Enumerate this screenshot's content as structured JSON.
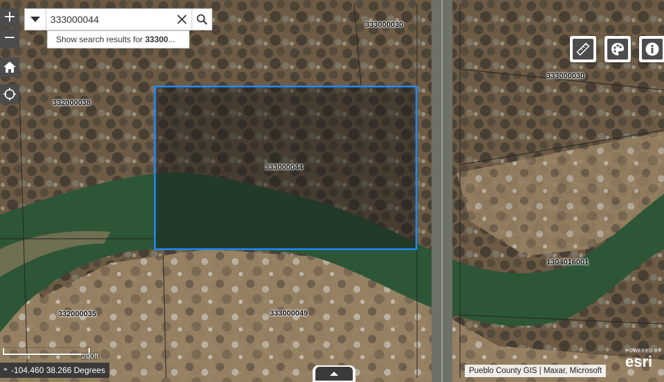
{
  "search": {
    "value": "333000044",
    "suggestion_prefix": "Show search results for ",
    "suggestion_bold": "33300",
    "suggestion_suffix": "..."
  },
  "map": {
    "zoom_in_label": "+",
    "zoom_out_label": "−",
    "parcels": [
      {
        "id": "p1",
        "label": "333000030"
      },
      {
        "id": "p2",
        "label": "333000030"
      },
      {
        "id": "p3",
        "label": "332000038"
      },
      {
        "id": "p4",
        "label": "333000044"
      },
      {
        "id": "p5",
        "label": "1304016001"
      },
      {
        "id": "p6",
        "label": "332000035"
      },
      {
        "id": "p7",
        "label": "333000049"
      }
    ],
    "selection_color": "#1e8cff"
  },
  "coordinates": "-104.460 38.266 Degrees",
  "scale_label": "200ft",
  "attribution": "Pueblo County GIS | Maxar, Microsoft",
  "esri": {
    "powered_by": "POWERED BY",
    "logo": "esri"
  },
  "icons": {
    "home": "home-icon",
    "locate": "locate-icon",
    "measure": "ruler-icon",
    "basemap": "palette-icon",
    "info": "info-icon",
    "search": "search-icon",
    "clear": "close-icon",
    "dropdown": "caret-down-icon",
    "collapse": "chevron-up-icon"
  }
}
